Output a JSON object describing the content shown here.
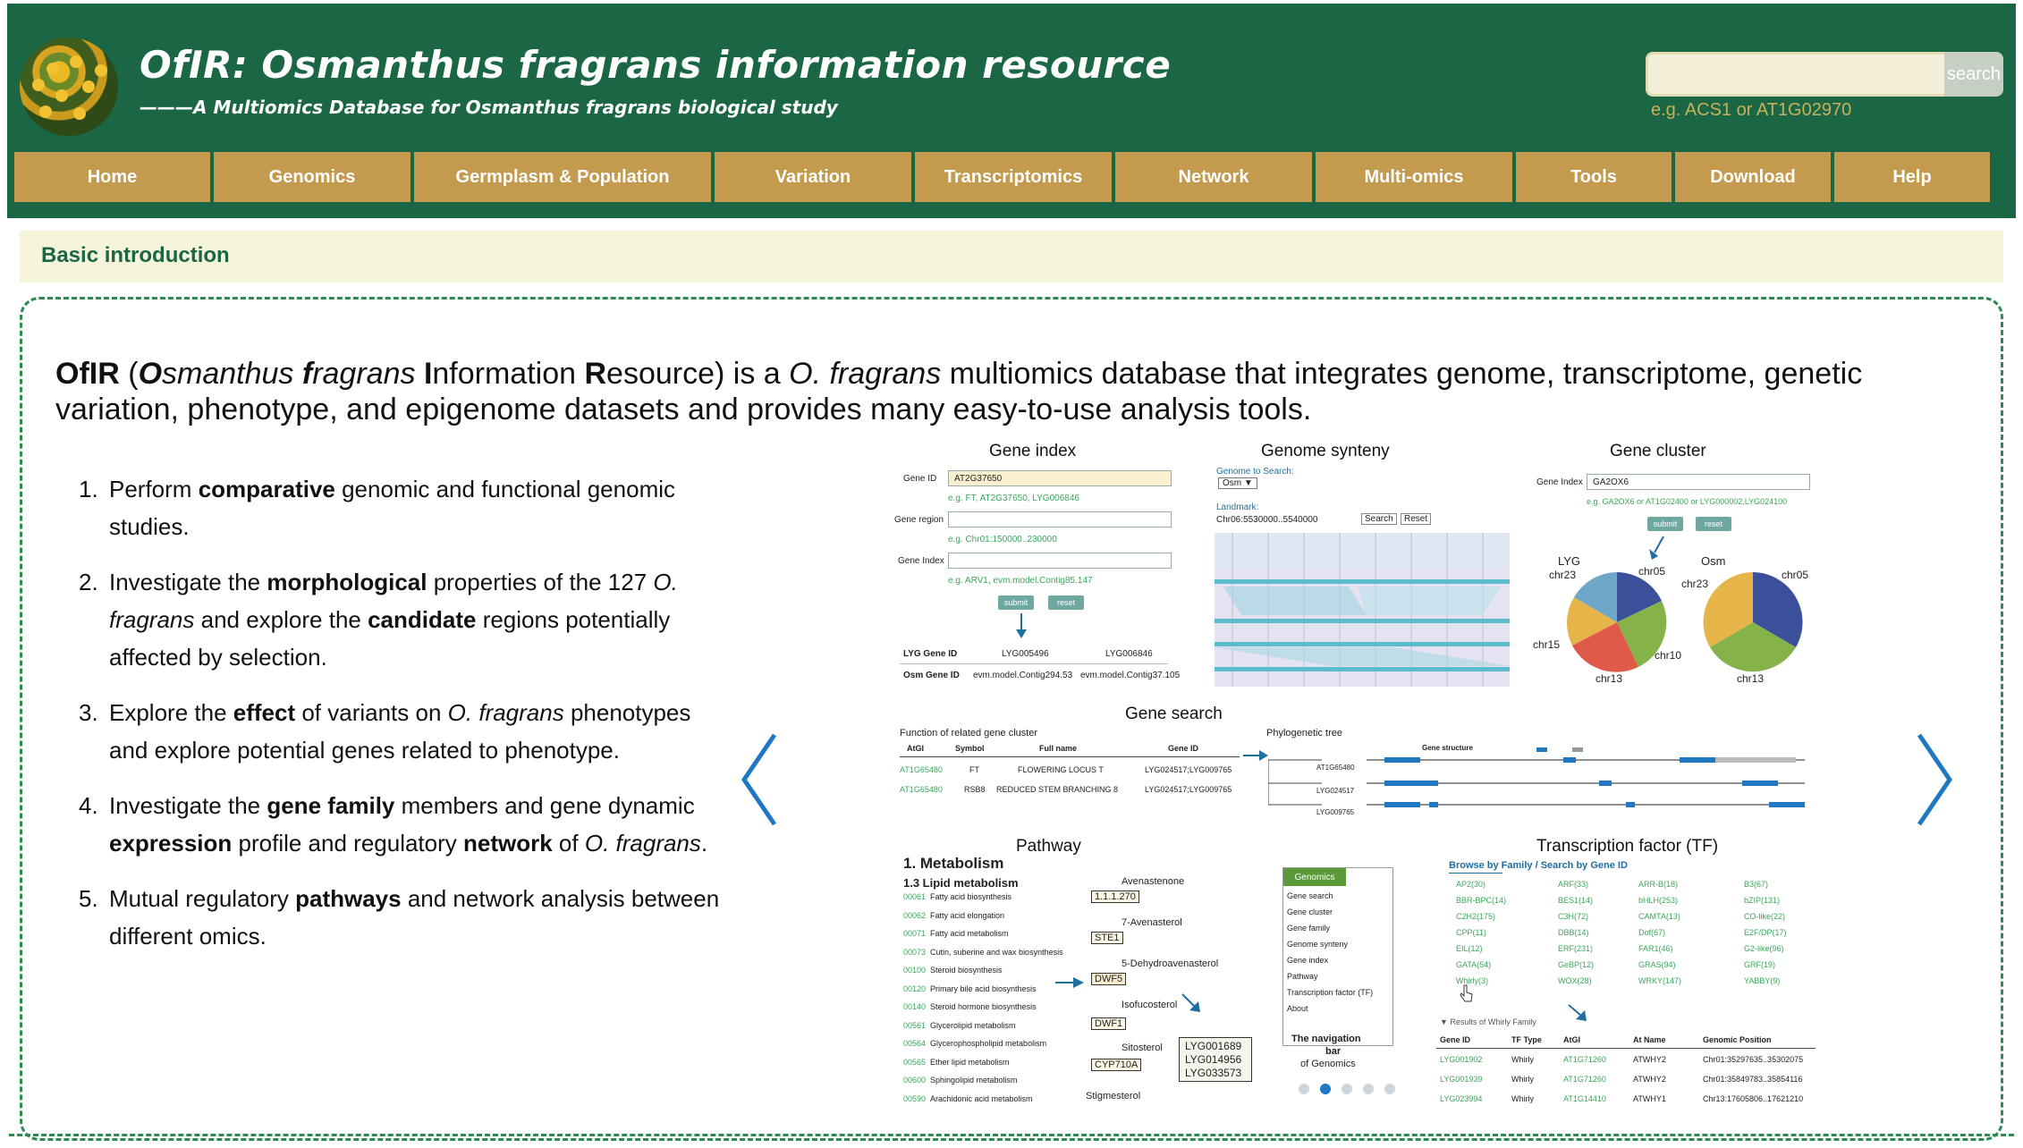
{
  "header": {
    "title": "OfIR: Osmanthus fragrans information resource",
    "subtitle": "———A Multiomics Database for Osmanthus fragrans biological study",
    "search_button": "search",
    "search_value": "",
    "search_hint": "e.g. ACS1 or AT1G02970"
  },
  "nav": {
    "items": [
      "Home",
      "Genomics",
      "Germplasm & Population",
      "Variation",
      "Transcriptomics",
      "Network",
      "Multi-omics",
      "Tools",
      "Download",
      "Help"
    ]
  },
  "section": {
    "title": "Basic introduction"
  },
  "intro": {
    "p1": "OfIR",
    "p2": " (",
    "p3": "O",
    "p4": "smanthus ",
    "p5": "f",
    "p6": "ragrans ",
    "p7": "I",
    "p8": "nformation ",
    "p9": "R",
    "p10": "esource) is a ",
    "p11": "O. fragrans",
    "p12": " multiomics database that integrates genome, transcriptome, genetic variation, phenotype, and epigenome datasets and provides many easy-to-use analysis tools."
  },
  "features": [
    {
      "num": "1.",
      "a": "Perform ",
      "b": "comparative",
      "c": " genomic and functional genomic studies."
    },
    {
      "num": "2.",
      "a": "Investigate the ",
      "b": "morphological",
      "c": " properties of the 127 ",
      "d": "O. fragrans",
      "e": " and explore the ",
      "f": "candidate",
      "g": " regions potentially affected by selection."
    },
    {
      "num": "3.",
      "a": "Explore the ",
      "b": "effect",
      "c": " of variants on ",
      "d": "O. fragrans",
      "e": " phenotypes and explore potential genes related to phenotype."
    },
    {
      "num": "4.",
      "a": "Investigate the ",
      "b": "gene family",
      "c": " members and gene dynamic ",
      "d": "expression",
      "e": " profile and regulatory ",
      "f": "network",
      "g": " of ",
      "h": "O. fragrans",
      "i": "."
    },
    {
      "num": "5.",
      "a": "Mutual regulatory ",
      "b": "pathways",
      "c": " and network analysis between different omics."
    }
  ],
  "carousel": {
    "slides_count": 5,
    "active_slide": 2,
    "panels": {
      "gene_index": {
        "title": "Gene index",
        "gene_id_label": "Gene ID",
        "gene_id_value": "AT2G37650",
        "gene_id_eg": "e.g. FT, AT2G37650, LYG006846",
        "region_label": "Gene region",
        "region_eg": "e.g. Chr01:150000..230000",
        "index_label": "Gene Index",
        "index_eg": "e.g. ARV1, evm.model.Contig85.147",
        "submit": "submit",
        "reset": "reset",
        "lyg_label": "LYG Gene ID",
        "lyg_1": "LYG005496",
        "lyg_2": "LYG006846",
        "osm_label": "Osm Gene ID",
        "osm_1": "evm.model.Contig294.53",
        "osm_2": "evm.model.Contig37.105"
      },
      "synteny": {
        "title": "Genome synteny",
        "genome_label": "Genome to Search:",
        "genome_value": "Osm ▼",
        "landmark_label": "Landmark:",
        "landmark_value": "Chr06:5530000..5540000",
        "search": "Search",
        "reset": "Reset"
      },
      "cluster": {
        "title": "Gene cluster",
        "index_label": "Gene Index",
        "index_value": "GA2OX6",
        "eg": "e.g. GA2OX6 or AT1G02400 or LYG000002,LYG024100",
        "submit": "submit",
        "reset": "reset",
        "pie1_name": "LYG",
        "pie2_name": "Osm",
        "labels": [
          "chr23",
          "chr05",
          "chr15",
          "chr10",
          "chr13"
        ],
        "labels2": [
          "chr23",
          "chr05",
          "chr13"
        ]
      },
      "gene_search": {
        "title": "Gene search",
        "sub1": "Function of related gene cluster",
        "sub2": "Phylogenetic tree",
        "col1": "AtGI",
        "col2": "Symbol",
        "col3": "Full name",
        "col4": "Gene ID",
        "gene_structure": "Gene structure",
        "row1": [
          "AT1G65480",
          "FT",
          "FLOWERING LOCUS T",
          "LYG024517;LYG009765"
        ],
        "row2": [
          "AT1G65480",
          "RSB8",
          "REDUCED STEM BRANCHING 8",
          "LYG024517;LYG009765"
        ],
        "tree": [
          "AT1G65480",
          "LYG024517",
          "LYG009765"
        ]
      },
      "pathway": {
        "title": "Pathway",
        "h1": "1. Metabolism",
        "h2": "1.3 Lipid metabolism",
        "items": [
          [
            "00061",
            "Fatty acid biosynthesis"
          ],
          [
            "00062",
            "Fatty acid elongation"
          ],
          [
            "00071",
            "Fatty acid metabolism"
          ],
          [
            "00073",
            "Cutin, suberine and wax biosynthesis"
          ],
          [
            "00100",
            "Steroid biosynthesis"
          ],
          [
            "00120",
            "Primary bile acid biosynthesis"
          ],
          [
            "00140",
            "Steroid hormone biosynthesis"
          ],
          [
            "00561",
            "Glycerolipid metabolism"
          ],
          [
            "00564",
            "Glycerophospholipid metabolism"
          ],
          [
            "00565",
            "Ether lipid metabolism"
          ],
          [
            "00600",
            "Sphingolipid metabolism"
          ],
          [
            "00590",
            "Arachidonic acid metabolism"
          ]
        ],
        "compounds": [
          "Avenastenone",
          "7-Avenasterol",
          "5-Dehydroavenasterol",
          "Isofucosterol",
          "Sitosterol",
          "Stigmesterol"
        ],
        "enzymes": [
          "1.1.1.270",
          "STE1",
          "DWF5",
          "DWF1",
          "CYP710A"
        ],
        "gene_box": [
          "LYG001689",
          "LYG014956",
          "LYG033573"
        ]
      },
      "nav_menu": {
        "header": "Genomics",
        "items": [
          "Gene search",
          "Gene cluster",
          "Gene family",
          "Genome synteny",
          "Gene index",
          "Pathway",
          "Transcription factor (TF)",
          "About"
        ],
        "caption1": "The navigation",
        "caption2": "bar",
        "caption3": "of Genomics"
      },
      "tf": {
        "title": "Transcription factor (TF)",
        "tabs": "Browse by Family / Search by Gene ID",
        "families": [
          [
            "AP2(30)",
            "ARF(33)",
            "ARR-B(18)",
            "B3(67)"
          ],
          [
            "BBR-BPC(14)",
            "BES1(14)",
            "bHLH(253)",
            "bZIP(131)"
          ],
          [
            "C2H2(175)",
            "C3H(72)",
            "CAMTA(13)",
            "CO-like(22)"
          ],
          [
            "CPP(11)",
            "DBB(14)",
            "Dof(67)",
            "E2F/DP(17)"
          ],
          [
            "EIL(12)",
            "ERF(231)",
            "FAR1(46)",
            "G2-like(96)"
          ],
          [
            "GATA(54)",
            "GeBP(12)",
            "GRAS(94)",
            "GRF(19)"
          ],
          [
            "Whirly(3)",
            "WOX(28)",
            "WRKY(147)",
            "YABBY(9)"
          ]
        ],
        "results_label": "▼ Results of Whirly Family",
        "cols": [
          "Gene ID",
          "TF Type",
          "AtGI",
          "At Name",
          "Genomic Position"
        ],
        "rows": [
          [
            "LYG001902",
            "Whirly",
            "AT1G71260",
            "ATWHY2",
            "Chr01:35297635..35302075"
          ],
          [
            "LYG001939",
            "Whirly",
            "AT1G71260",
            "ATWHY2",
            "Chr01:35849783..35854116"
          ],
          [
            "LYG023994",
            "Whirly",
            "AT1G14410",
            "ATWHY1",
            "Chr13:17605806..17621210"
          ]
        ]
      }
    }
  },
  "colors": {
    "header_bg": "#1a6645",
    "nav_bg": "#c49a4e",
    "section_bg": "#f7f4dc",
    "accent_green": "#2f8a52",
    "arrow_blue": "#1f78c1"
  }
}
